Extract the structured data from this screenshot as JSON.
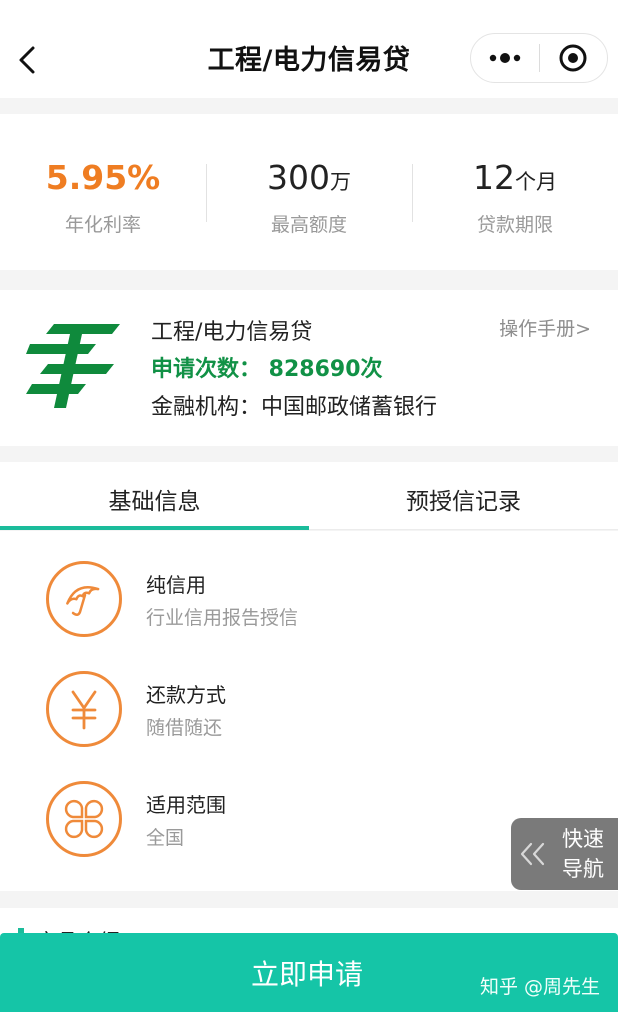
{
  "nav": {
    "title": "工程/电力信易贷",
    "icons": [
      "back-chevron-icon",
      "more-dots-icon",
      "record-target-icon"
    ]
  },
  "stats": [
    {
      "value": "5.95%",
      "unit": "",
      "label": "年化利率"
    },
    {
      "value": "300",
      "unit": "万",
      "label": "最高额度"
    },
    {
      "value": "12",
      "unit": "个月",
      "label": "贷款期限"
    }
  ],
  "product": {
    "name": "工程/电力信易贷",
    "apply_count": "申请次数： 828690次",
    "institution": "金融机构：中国邮政储蓄银行",
    "manual_link": "操作手册>",
    "logo_icon": "china-post-logo"
  },
  "tabs": [
    {
      "label": "基础信息",
      "active": true
    },
    {
      "label": "预授信记录",
      "active": false
    }
  ],
  "info_items": [
    {
      "icon": "umbrella-icon",
      "title": "纯信用",
      "subtitle": "行业信用报告授信"
    },
    {
      "icon": "yen-icon",
      "title": "还款方式",
      "subtitle": "随借随还"
    },
    {
      "icon": "clover-icon",
      "title": "适用范围",
      "subtitle": "全国"
    }
  ],
  "quick_nav": {
    "line1": "快速",
    "line2": "导航"
  },
  "section2": {
    "title": "产品介绍"
  },
  "apply_button": "立即申请",
  "watermark": "知乎 @周先生",
  "colors": {
    "accent": "#15c5a7",
    "orange": "#ef7d22",
    "green": "#119146",
    "post_green": "#0f8a3c"
  }
}
